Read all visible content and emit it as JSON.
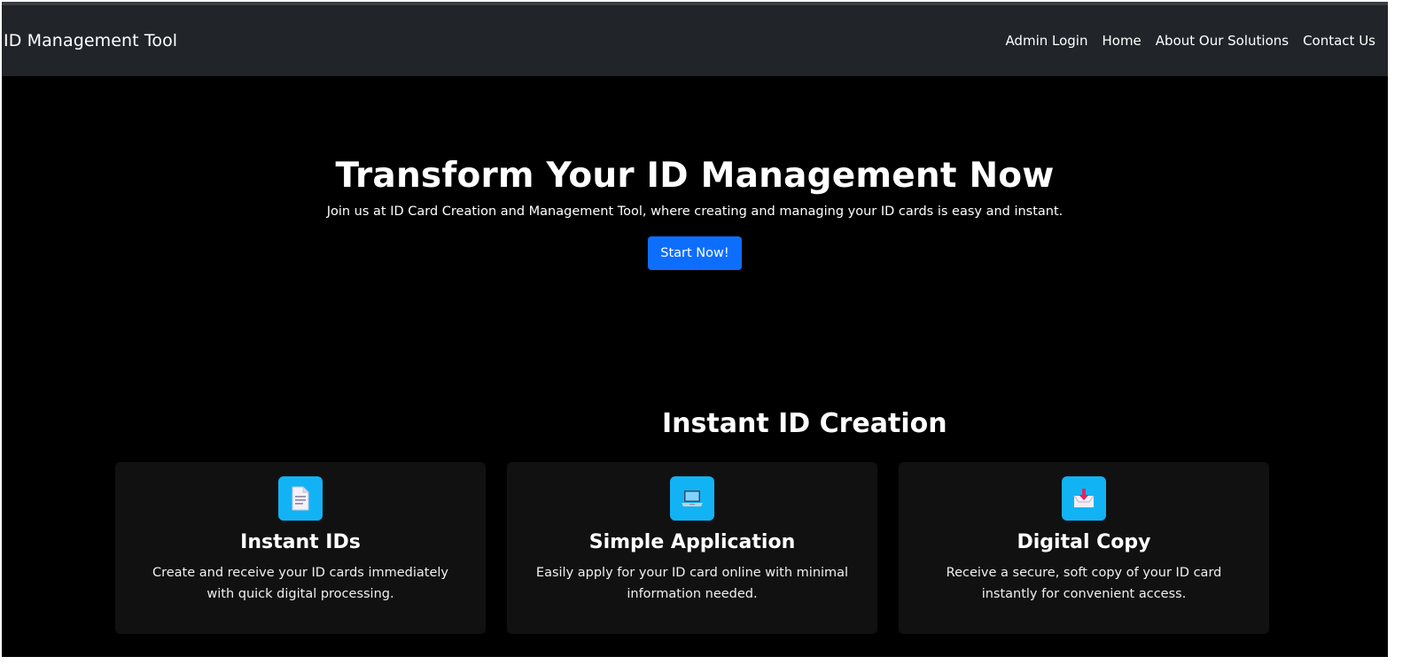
{
  "navbar": {
    "brand": "ID Management Tool",
    "links": [
      "Admin Login",
      "Home",
      "About Our Solutions",
      "Contact Us"
    ]
  },
  "hero": {
    "title": "Transform Your ID Management Now",
    "subtitle": "Join us at ID Card Creation and Management Tool, where creating and managing your ID cards is easy and instant.",
    "button_label": "Start Now!"
  },
  "features": {
    "title": "Instant ID Creation",
    "cards": [
      {
        "icon": "document-icon",
        "title": "Instant IDs",
        "text": "Create and receive your ID cards immediately with quick digital processing."
      },
      {
        "icon": "laptop-icon",
        "title": "Simple Application",
        "text": "Easily apply for your ID card online with minimal information needed."
      },
      {
        "icon": "inbox-download-icon",
        "title": "Digital Copy",
        "text": "Receive a secure, soft copy of your ID card instantly for convenient access."
      }
    ]
  },
  "colors": {
    "navbar_bg": "#212529",
    "page_bg": "#000000",
    "primary_button": "#0d6efd",
    "icon_bg": "#12b3f5",
    "card_bg": "#111112"
  }
}
